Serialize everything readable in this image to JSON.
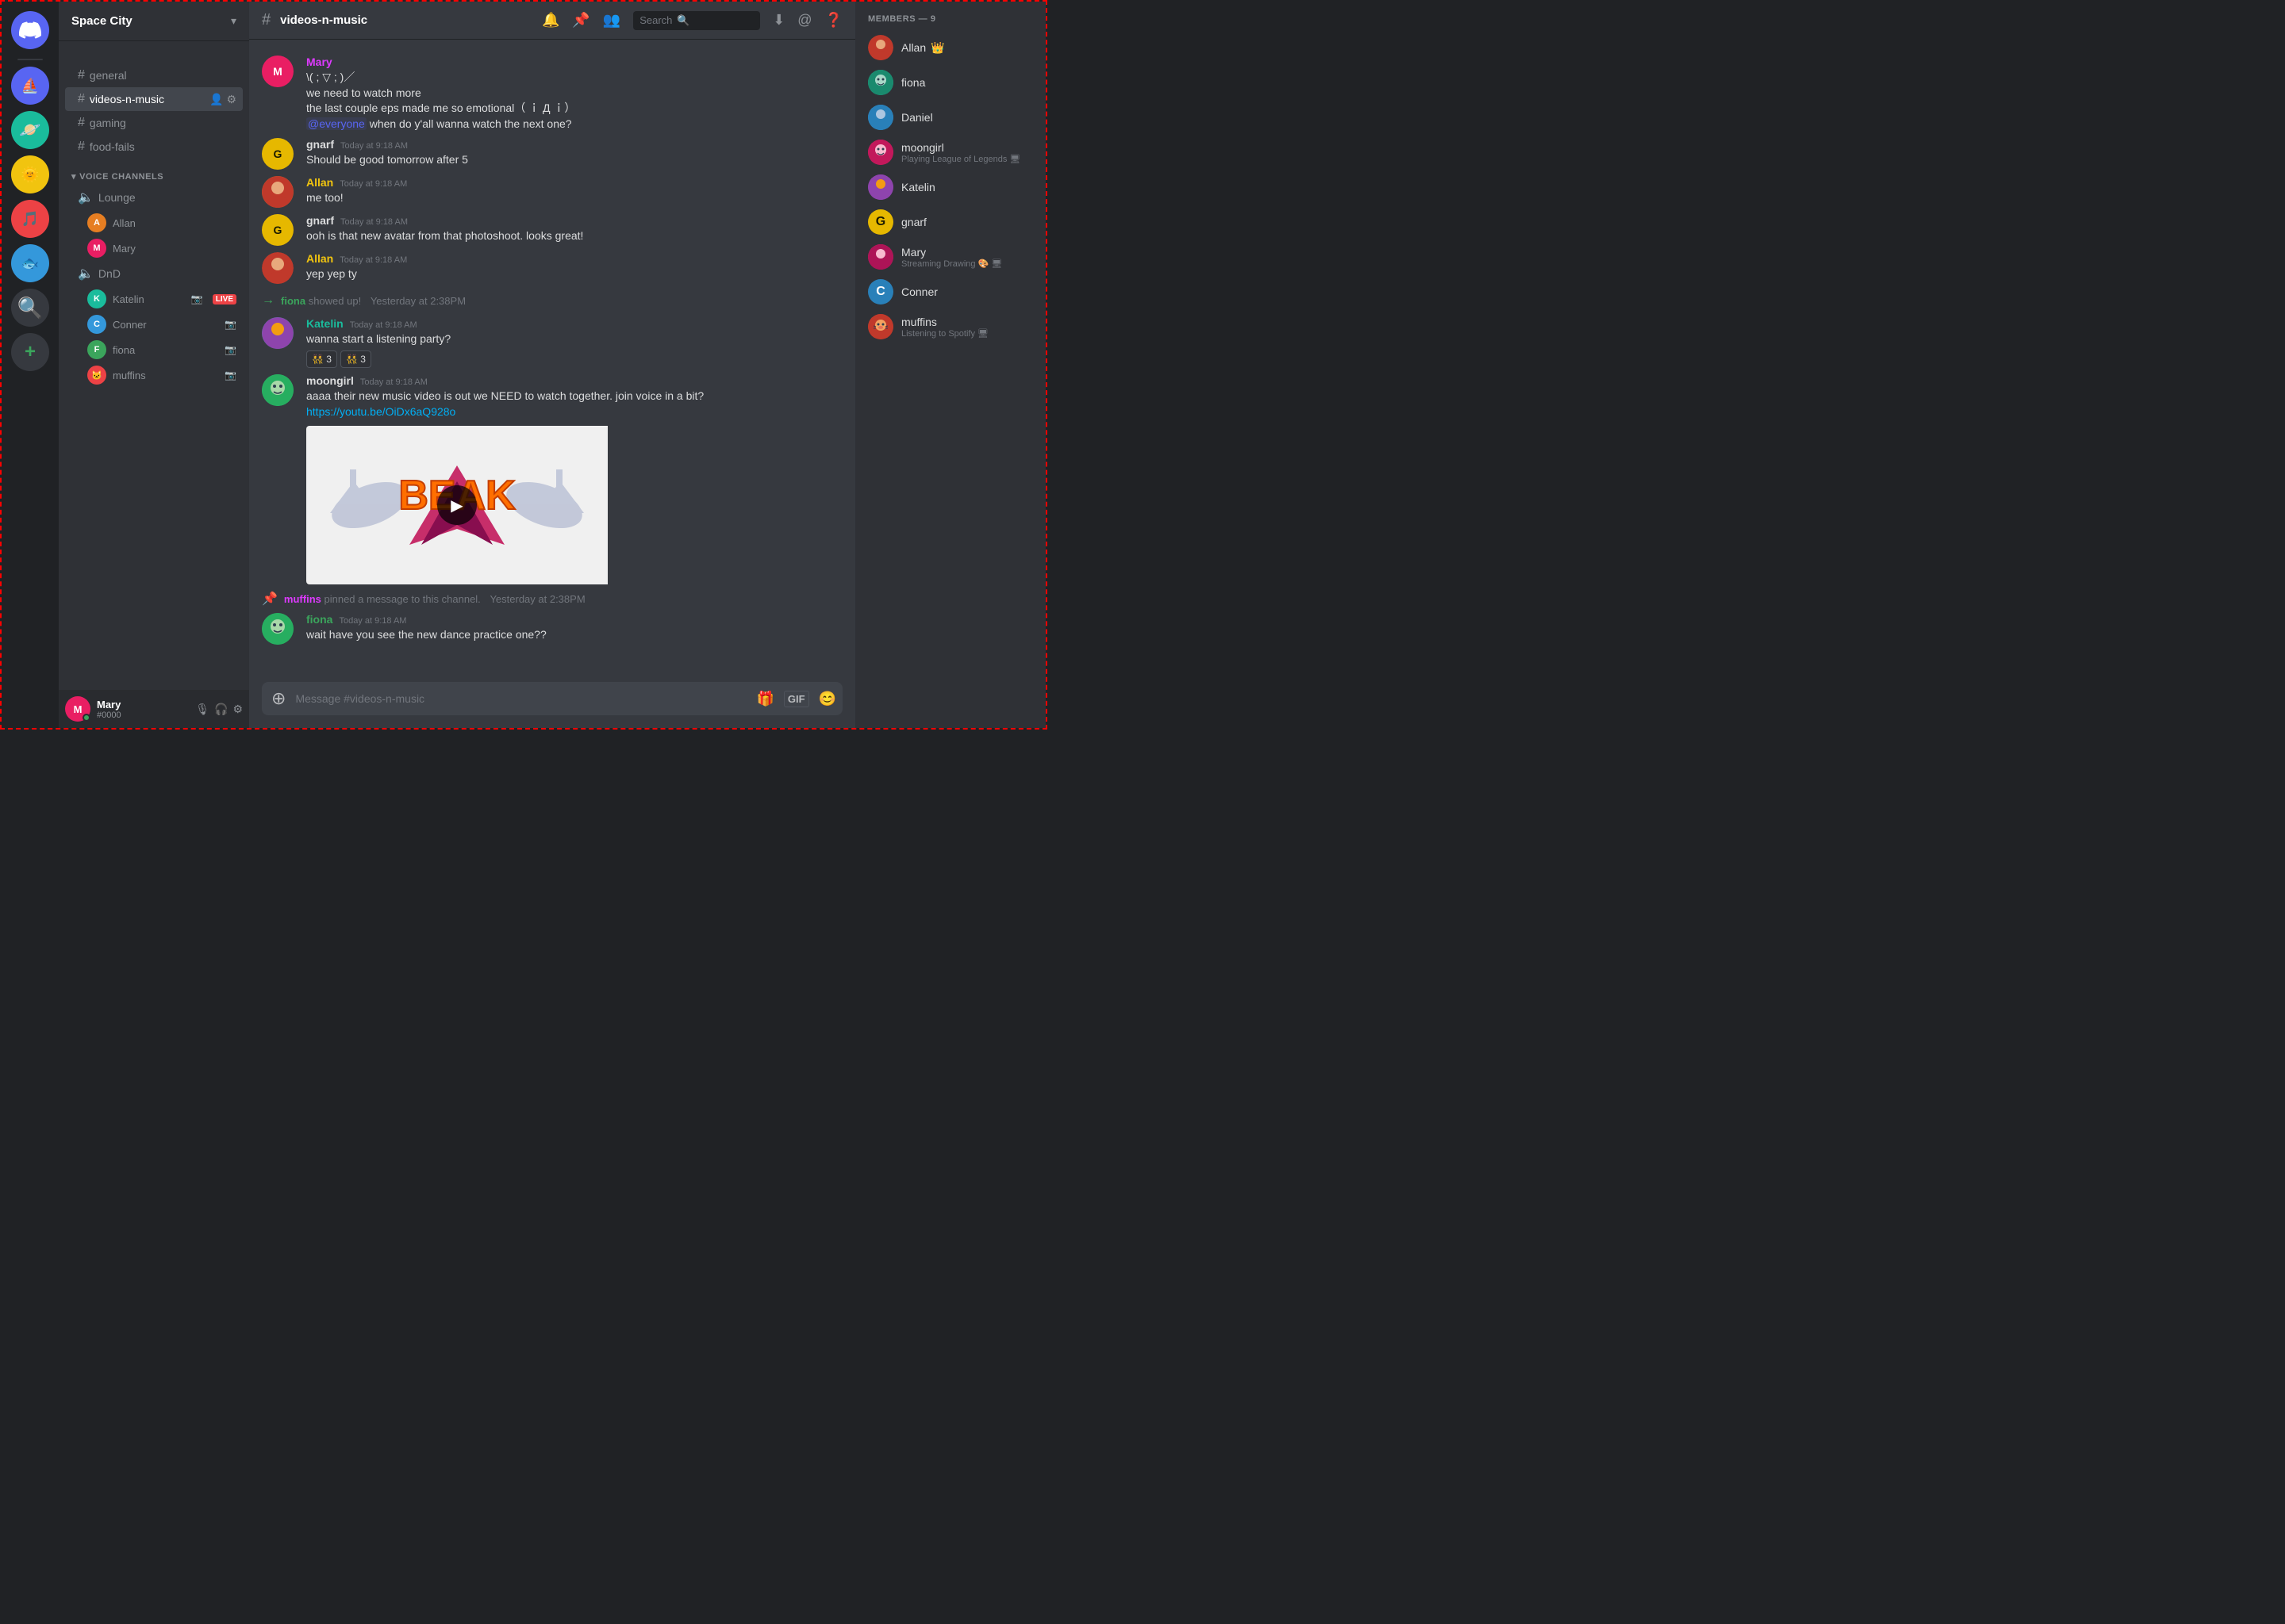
{
  "app": {
    "title": "DISCORD"
  },
  "server": {
    "name": "Space City",
    "dropdown_label": "Space City"
  },
  "channel": {
    "active": "videos-n-music",
    "hash_symbol": "#"
  },
  "sidebar": {
    "text_channels": [
      {
        "name": "general",
        "active": false
      },
      {
        "name": "videos-n-music",
        "active": true
      },
      {
        "name": "gaming",
        "active": false
      },
      {
        "name": "food-fails",
        "active": false
      }
    ],
    "voice_section": "VOICE CHANNELS",
    "voice_channels": [
      {
        "name": "Lounge",
        "members": [
          {
            "name": "Allan",
            "color": "av-orange"
          },
          {
            "name": "Mary",
            "color": "av-pink"
          }
        ]
      },
      {
        "name": "DnD",
        "members": [
          {
            "name": "Katelin",
            "color": "av-teal",
            "live": true
          },
          {
            "name": "Conner",
            "color": "av-blue"
          },
          {
            "name": "fiona",
            "color": "av-green"
          },
          {
            "name": "muffins",
            "color": "av-red"
          }
        ]
      }
    ]
  },
  "header": {
    "channel_name": "videos-n-music",
    "search_placeholder": "Search",
    "icons": [
      "bell",
      "pin",
      "members",
      "search",
      "download",
      "at",
      "help"
    ]
  },
  "messages": [
    {
      "id": "mary1",
      "author": "Mary",
      "author_color": "#de3aff",
      "avatar_color": "av-pink",
      "avatar_letter": "M",
      "time": "",
      "lines": [
        "\\( ; ▽ ; )／",
        "we need to watch more",
        "the last couple eps made me so emotional（ ｉ Д ｉ）",
        "@everyone when do y'all wanna watch the next one?"
      ],
      "mention": "@everyone",
      "type": "message"
    },
    {
      "id": "gnarf1",
      "author": "gnarf",
      "author_color": "#dcddde",
      "avatar_color": "av-yellow",
      "avatar_letter": "G",
      "time": "Today at 9:18 AM",
      "text": "Should be good tomorrow after 5",
      "type": "message"
    },
    {
      "id": "allan1",
      "author": "Allan",
      "author_color": "#f1c40f",
      "avatar_color": "av-orange",
      "avatar_letter": "A",
      "time": "Today at 9:18 AM",
      "text": "me too!",
      "type": "message"
    },
    {
      "id": "gnarf2",
      "author": "gnarf",
      "author_color": "#dcddde",
      "avatar_color": "av-yellow",
      "avatar_letter": "G",
      "time": "Today at 9:18 AM",
      "text": "ooh is that new avatar from that photoshoot. looks great!",
      "type": "message"
    },
    {
      "id": "allan2",
      "author": "Allan",
      "author_color": "#f1c40f",
      "avatar_color": "av-orange",
      "avatar_letter": "A",
      "time": "Today at 9:18 AM",
      "text": "yep yep ty",
      "type": "message"
    },
    {
      "id": "fiona_system",
      "type": "join",
      "text": "fiona",
      "subtext": "showed up!",
      "time": "Yesterday at 2:38PM"
    },
    {
      "id": "katelin1",
      "author": "Katelin",
      "author_color": "#1abc9c",
      "avatar_color": "av-teal",
      "avatar_letter": "K",
      "time": "Today at 9:18 AM",
      "text": "wanna start a listening party?",
      "reactions": [
        {
          "emoji": "👯",
          "count": 3
        },
        {
          "emoji": "👯",
          "count": 3
        }
      ],
      "type": "message"
    },
    {
      "id": "moongirl1",
      "author": "moongirl",
      "author_color": "#dcddde",
      "avatar_color": "av-teal",
      "avatar_letter": "🐸",
      "time": "Today at 9:18 AM",
      "text": "aaaa their new music video is out we NEED to watch together. join voice in a bit?",
      "link": "https://youtu.be/OiDx6aQ928o",
      "has_embed": true,
      "type": "message"
    },
    {
      "id": "pin_system",
      "type": "pin",
      "author": "muffins",
      "text": "pinned a message to this channel.",
      "time": "Yesterday at 2:38PM"
    },
    {
      "id": "fiona2",
      "author": "fiona",
      "author_color": "#3ba55c",
      "avatar_color": "av-green",
      "avatar_letter": "🌿",
      "time": "Today at 9:18 AM",
      "text": "wait have you see the new dance practice one??",
      "type": "message"
    }
  ],
  "members": {
    "header": "MEMBERS — 9",
    "list": [
      {
        "name": "Allan",
        "color": "av-orange",
        "letter": "A",
        "status": "",
        "crown": true
      },
      {
        "name": "fiona",
        "color": "av-teal",
        "letter": "🐸",
        "status": ""
      },
      {
        "name": "Daniel",
        "color": "av-blue",
        "letter": "D",
        "status": ""
      },
      {
        "name": "moongirl",
        "color": "av-pink",
        "letter": "🐸",
        "status": "Playing League of Legends",
        "has_screen": true
      },
      {
        "name": "Katelin",
        "color": "av-yellow",
        "letter": "K",
        "status": ""
      },
      {
        "name": "gnarf",
        "color": "av-orange",
        "letter": "G",
        "status": ""
      },
      {
        "name": "Mary",
        "color": "av-pink",
        "letter": "M",
        "status": "Streaming Drawing 🎨",
        "has_screen": true
      },
      {
        "name": "Conner",
        "color": "av-blue",
        "letter": "C",
        "status": ""
      },
      {
        "name": "muffins",
        "color": "av-red",
        "letter": "🐱",
        "status": "Listening to Spotify",
        "has_screen": true
      }
    ]
  },
  "user": {
    "name": "Mary",
    "tag": "#0000",
    "status": "online"
  },
  "input": {
    "placeholder": "Message #videos-n-music"
  }
}
